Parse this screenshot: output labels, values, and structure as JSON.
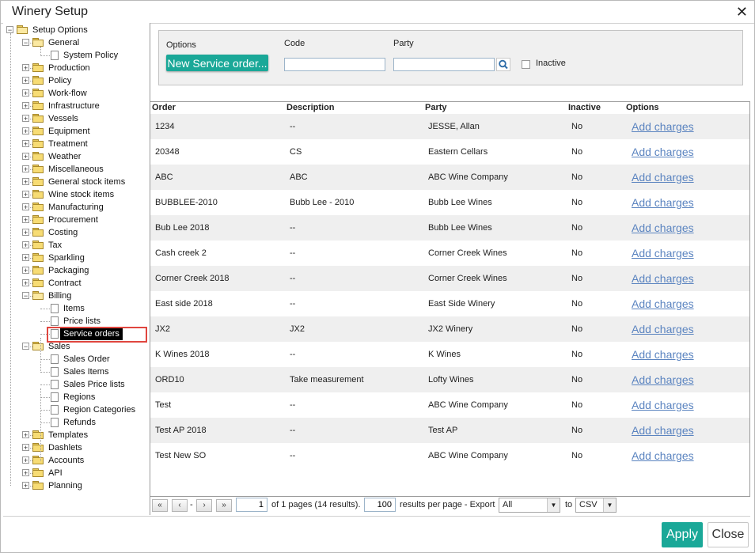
{
  "window": {
    "title": "Winery Setup",
    "close_glyph": "✕"
  },
  "tree": {
    "root": "Setup Options",
    "general": "General",
    "general_children": [
      "System Policy"
    ],
    "folders_a": [
      "Production",
      "Policy",
      "Work-flow",
      "Infrastructure",
      "Vessels",
      "Equipment",
      "Treatment",
      "Weather",
      "Miscellaneous",
      "General stock items",
      "Wine stock items",
      "Manufacturing",
      "Procurement",
      "Costing",
      "Tax",
      "Sparkling",
      "Packaging",
      "Contract"
    ],
    "billing": "Billing",
    "billing_children": [
      "Items",
      "Price lists",
      "Service orders"
    ],
    "sales": "Sales",
    "sales_children": [
      "Sales Order",
      "Sales Items",
      "Sales Price lists",
      "Regions",
      "Region Categories",
      "Refunds"
    ],
    "folders_b": [
      "Templates",
      "Dashlets",
      "Accounts",
      "API",
      "Planning"
    ],
    "selected": "Service orders"
  },
  "filter": {
    "options_label": "Options",
    "new_button": "New Service order...",
    "code_label": "Code",
    "code_value": "",
    "party_label": "Party",
    "party_value": "",
    "inactive_label": "Inactive",
    "inactive_checked": false
  },
  "table": {
    "headers": {
      "order": "Order",
      "description": "Description",
      "party": "Party",
      "inactive": "Inactive",
      "options": "Options"
    },
    "rows": [
      {
        "order": "1234",
        "description": "--",
        "party": "JESSE, Allan",
        "inactive": "No",
        "action": "Add charges"
      },
      {
        "order": "20348",
        "description": "CS",
        "party": "Eastern Cellars",
        "inactive": "No",
        "action": "Add charges"
      },
      {
        "order": "ABC",
        "description": "ABC",
        "party": "ABC Wine Company",
        "inactive": "No",
        "action": "Add charges"
      },
      {
        "order": "BUBBLEE-2010",
        "description": "Bubb Lee - 2010",
        "party": "Bubb Lee Wines",
        "inactive": "No",
        "action": "Add charges"
      },
      {
        "order": "Bub Lee 2018",
        "description": "--",
        "party": "Bubb Lee Wines",
        "inactive": "No",
        "action": "Add charges"
      },
      {
        "order": "Cash creek 2",
        "description": "--",
        "party": "Corner Creek Wines",
        "inactive": "No",
        "action": "Add charges"
      },
      {
        "order": "Corner Creek 2018",
        "description": "--",
        "party": "Corner Creek Wines",
        "inactive": "No",
        "action": "Add charges"
      },
      {
        "order": "East side 2018",
        "description": "--",
        "party": "East Side Winery",
        "inactive": "No",
        "action": "Add charges"
      },
      {
        "order": "JX2",
        "description": "JX2",
        "party": "JX2 Winery",
        "inactive": "No",
        "action": "Add charges"
      },
      {
        "order": "K Wines 2018",
        "description": "--",
        "party": "K Wines",
        "inactive": "No",
        "action": "Add charges"
      },
      {
        "order": "ORD10",
        "description": "Take measurement",
        "party": "Lofty Wines",
        "inactive": "No",
        "action": "Add charges"
      },
      {
        "order": "Test",
        "description": "--",
        "party": "ABC Wine Company",
        "inactive": "No",
        "action": "Add charges"
      },
      {
        "order": "Test AP 2018",
        "description": "--",
        "party": "Test AP",
        "inactive": "No",
        "action": "Add charges"
      },
      {
        "order": "Test New SO",
        "description": "--",
        "party": "ABC Wine Company",
        "inactive": "No",
        "action": "Add charges"
      }
    ]
  },
  "pager": {
    "first": "«",
    "prev": "‹",
    "dash": "-",
    "next": "›",
    "last": "»",
    "page_value": "1",
    "pages_text": "of 1 pages (14 results).",
    "per_page_value": "100",
    "per_page_text": "results per page - Export",
    "export_option": "All",
    "to_text": "to",
    "format_option": "CSV"
  },
  "footer": {
    "apply": "Apply",
    "close": "Close"
  },
  "colors": {
    "accent": "#1aa898",
    "link": "#5b84c0",
    "highlight": "#e0463f"
  }
}
